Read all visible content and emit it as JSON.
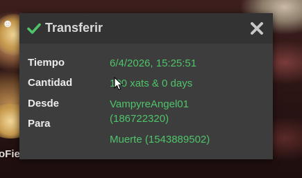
{
  "background": {
    "partial_text": "oFie"
  },
  "dialog": {
    "title": "Transferir",
    "icons": {
      "title": "check-icon",
      "close": "close-icon"
    },
    "colors": {
      "accent": "#4fc46a",
      "header_bg": "#333333",
      "body_bg": "#3d3d3d",
      "label": "#ececec"
    },
    "rows": {
      "time": {
        "label": "Tiempo",
        "value": "6/4/2026, 15:25:51"
      },
      "amount": {
        "label": "Cantidad",
        "value": "100 xats & 0 days"
      },
      "from": {
        "label": "Desde",
        "value_line1": "VampyreAngel01",
        "value_line2": "(186722320)"
      },
      "to": {
        "label": "Para",
        "value": "Muerte (1543889502)"
      }
    }
  }
}
